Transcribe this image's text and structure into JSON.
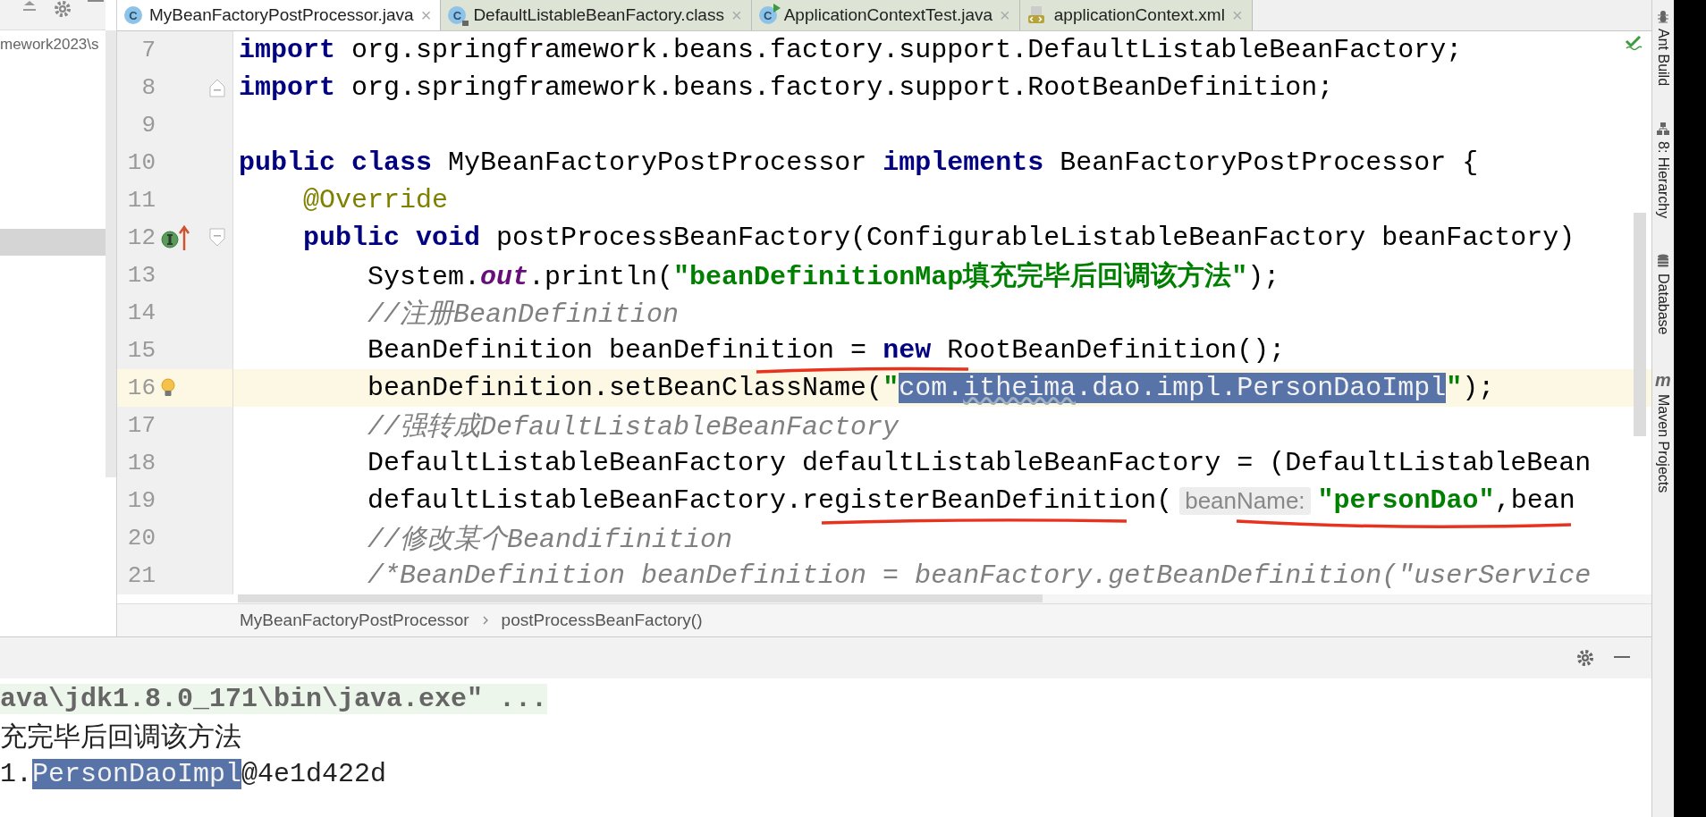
{
  "project_panel": {
    "path": "mework2023\\s"
  },
  "editor_tabs": [
    {
      "label": "MyBeanFactoryPostProcessor.java",
      "icon_text": "C",
      "kind": "class",
      "close": "×",
      "selected": true
    },
    {
      "label": "DefaultListableBeanFactory.class",
      "icon_text": "C",
      "kind": "locked-class",
      "close": "×",
      "selected": false
    },
    {
      "label": "ApplicationContextTest.java",
      "icon_text": "C",
      "kind": "test-class",
      "close": "×",
      "selected": false
    },
    {
      "label": "applicationContext.xml",
      "kind": "xml",
      "close": "×",
      "selected": false
    }
  ],
  "code_lines": [
    {
      "number": "7",
      "current": false,
      "segments": [
        {
          "kind": "keyword",
          "text": "import"
        },
        {
          "kind": "plain",
          "text": " org.springframework.beans.factory.support.DefaultListableBeanFactory;"
        }
      ]
    },
    {
      "number": "8",
      "current": false,
      "gutter_marks": [
        {
          "kind": "fold-end"
        }
      ],
      "segments": [
        {
          "kind": "keyword",
          "text": "import"
        },
        {
          "kind": "plain",
          "text": " org.springframework.beans.factory.support.RootBeanDefinition;"
        }
      ]
    },
    {
      "number": "9",
      "current": false
    },
    {
      "number": "10",
      "current": false,
      "segments": [
        {
          "kind": "keyword",
          "text": "public"
        },
        {
          "kind": "keyword",
          "text": " class"
        },
        {
          "kind": "plain",
          "text": " MyBeanFactoryPostProcessor "
        },
        {
          "kind": "keyword",
          "text": "implements"
        },
        {
          "kind": "plain",
          "text": " BeanFactoryPostProcessor {"
        }
      ]
    },
    {
      "number": "11",
      "current": false,
      "segments": [
        {
          "kind": "annotation",
          "text": "    @Override"
        }
      ]
    },
    {
      "number": "12",
      "current": false,
      "gutter_marks": [
        {
          "kind": "implements"
        },
        {
          "kind": "fold-start"
        }
      ],
      "segments": [
        {
          "kind": "keyword",
          "text": "    public"
        },
        {
          "kind": "keyword",
          "text": " void"
        },
        {
          "kind": "plain",
          "text": " postProcessBeanFactory(ConfigurableListableBeanFactory beanFactory)"
        }
      ]
    },
    {
      "number": "13",
      "current": false,
      "segments": [
        {
          "kind": "plain",
          "text": "        System."
        },
        {
          "kind": "static",
          "text": "out"
        },
        {
          "kind": "plain",
          "text": ".println("
        },
        {
          "kind": "string",
          "text": "\"beanDefinitionMap填充完毕后回调该方法\""
        },
        {
          "kind": "plain",
          "text": ");"
        }
      ]
    },
    {
      "number": "14",
      "current": false,
      "segments": [
        {
          "kind": "comment",
          "text": "        //注册BeanDefinition"
        }
      ]
    },
    {
      "number": "15",
      "current": false,
      "segments": [
        {
          "kind": "plain",
          "text": "        BeanDefinition beanDefinition = "
        },
        {
          "kind": "keyword",
          "text": "new"
        },
        {
          "kind": "plain",
          "text": " RootBeanDefinition();"
        }
      ]
    },
    {
      "number": "16",
      "current": true,
      "gutter_marks": [
        {
          "kind": "bulb"
        }
      ],
      "segments": [
        {
          "kind": "plain",
          "text": "        beanDefinition.setBeanClassName("
        },
        {
          "kind": "string",
          "text": "\""
        },
        {
          "kind": "selection",
          "text": "com."
        },
        {
          "kind": "selection-typo",
          "text": "itheima"
        },
        {
          "kind": "selection",
          "text": ".dao.impl.PersonDaoImpl"
        },
        {
          "kind": "string",
          "text": "\""
        },
        {
          "kind": "plain",
          "text": ");"
        }
      ]
    },
    {
      "number": "17",
      "current": false,
      "segments": [
        {
          "kind": "comment",
          "text": "        //强转成DefaultListableBeanFactory"
        }
      ]
    },
    {
      "number": "18",
      "current": false,
      "segments": [
        {
          "kind": "plain",
          "text": "        DefaultListableBeanFactory defaultListableBeanFactory = (DefaultListableBean"
        }
      ]
    },
    {
      "number": "19",
      "current": false,
      "segments": [
        {
          "kind": "plain",
          "text": "        defaultListableBeanFactory.registerBeanDefinition("
        },
        {
          "kind": "hint",
          "text": "beanName:"
        },
        {
          "kind": "string",
          "text": "\"personDao\""
        },
        {
          "kind": "plain",
          "text": ",bean"
        }
      ]
    },
    {
      "number": "20",
      "current": false,
      "segments": [
        {
          "kind": "comment",
          "text": "        //修改某个Beandifinition"
        }
      ]
    },
    {
      "number": "21",
      "current": false,
      "segments": [
        {
          "kind": "comment",
          "text": "        /*BeanDefinition beanDefinition = beanFactory.getBeanDefinition(\"userService"
        }
      ]
    }
  ],
  "breadcrumbs": [
    "MyBeanFactoryPostProcessor",
    "postProcessBeanFactory()"
  ],
  "console_lines": [
    {
      "segments": [
        {
          "kind": "command",
          "text": "ava\\jdk1.8.0_171\\bin\\java.exe\" ..."
        }
      ]
    },
    {
      "segments": [
        {
          "kind": "plain",
          "text": "充完毕后回调该方法"
        }
      ]
    },
    {
      "segments": [
        {
          "kind": "plain",
          "text": "1."
        },
        {
          "kind": "selection",
          "text": "PersonDaoImpl"
        },
        {
          "kind": "plain",
          "text": "@4e1d422d"
        }
      ]
    }
  ],
  "tool_windows": [
    {
      "label": "Ant Build",
      "kind": "ant"
    },
    {
      "label": "8: Hierarchy",
      "kind": "hierarchy"
    },
    {
      "label": "Database",
      "kind": "database"
    },
    {
      "label": "Maven Projects",
      "kind": "maven",
      "icon_text": "m"
    }
  ]
}
